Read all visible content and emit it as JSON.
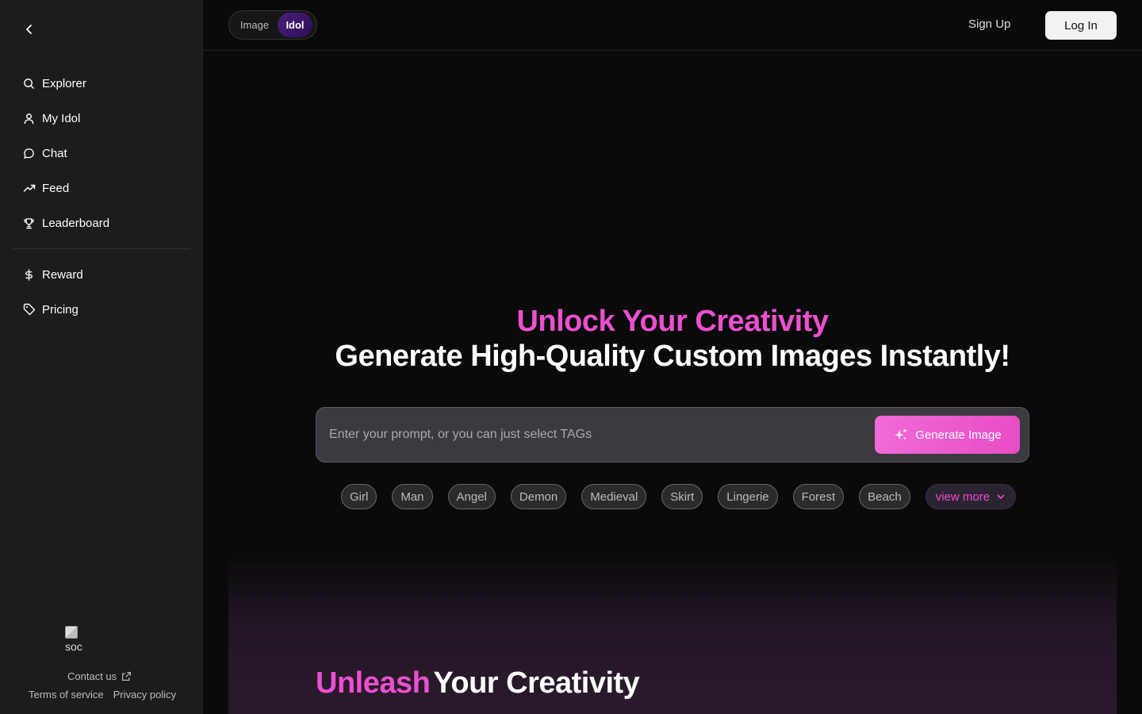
{
  "sidebar": {
    "nav_main": [
      {
        "label": "Explorer",
        "icon": "search-icon"
      },
      {
        "label": "My Idol",
        "icon": "user-icon"
      },
      {
        "label": "Chat",
        "icon": "chat-bubble-icon"
      },
      {
        "label": "Feed",
        "icon": "trending-icon"
      },
      {
        "label": "Leaderboard",
        "icon": "trophy-icon"
      }
    ],
    "nav_secondary": [
      {
        "label": "Reward",
        "icon": "dollar-icon"
      },
      {
        "label": "Pricing",
        "icon": "tag-icon"
      }
    ],
    "social_alt": "soc",
    "contact_label": "Contact us",
    "terms_label": "Terms of service",
    "privacy_label": "Privacy policy"
  },
  "topbar": {
    "toggle_image": "Image",
    "toggle_idol": "Idol",
    "signup_label": "Sign Up",
    "login_label": "Log In"
  },
  "hero": {
    "title_line1": "Unlock Your Creativity",
    "title_line2": "Generate High-Quality Custom Images Instantly!",
    "prompt_placeholder": "Enter your prompt, or you can just select TAGs",
    "generate_label": "Generate Image",
    "tags": [
      "Girl",
      "Man",
      "Angel",
      "Demon",
      "Medieval",
      "Skirt",
      "Lingerie",
      "Forest",
      "Beach"
    ],
    "view_more_label": "view more"
  },
  "lower": {
    "title_pink": "Unleash",
    "title_white": "Your Creativity"
  },
  "colors": {
    "accent_pink": "#ec4fd0",
    "sidebar_bg": "#1c1c1e",
    "page_bg": "#0a0a0a"
  }
}
